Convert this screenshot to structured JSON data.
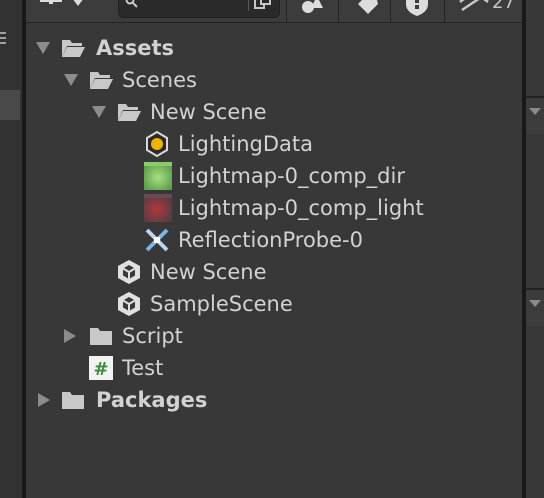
{
  "toolbar": {
    "search": {
      "value": "",
      "placeholder": ""
    },
    "hidden_count": "27",
    "icons": [
      "add-icon",
      "dropdown-caret-icon",
      "search-icon",
      "search-options-icon",
      "filter-by-type-icon",
      "filter-by-label-icon",
      "favorite-icon",
      "hidden-packages-icon"
    ]
  },
  "tree": {
    "items": [
      {
        "label": "Assets",
        "type": "folder-open",
        "expanded": true,
        "depth": 0
      },
      {
        "label": "Scenes",
        "type": "folder-open",
        "expanded": true,
        "depth": 1
      },
      {
        "label": "New Scene",
        "type": "folder-open",
        "expanded": true,
        "depth": 2
      },
      {
        "label": "LightingData",
        "type": "lighting-data",
        "depth": 3
      },
      {
        "label": "Lightmap-0_comp_dir",
        "type": "lightmap-dir",
        "depth": 3
      },
      {
        "label": "Lightmap-0_comp_light",
        "type": "lightmap-light",
        "depth": 3
      },
      {
        "label": "ReflectionProbe-0",
        "type": "reflection-probe",
        "depth": 3
      },
      {
        "label": "New Scene",
        "type": "unity-scene",
        "depth": 2
      },
      {
        "label": "SampleScene",
        "type": "unity-scene",
        "depth": 2
      },
      {
        "label": "Script",
        "type": "folder",
        "expanded": false,
        "depth": 1
      },
      {
        "label": "Test",
        "type": "csharp-script",
        "depth": 1
      },
      {
        "label": "Packages",
        "type": "folder",
        "expanded": false,
        "depth": 0
      }
    ]
  },
  "colors": {
    "panel_bg": "#383838",
    "toolbar_bg": "#3c3c3c",
    "text": "#d2d2d2",
    "folder_icon": "#c8c8c8",
    "script_icon_green": "#3c8c3c",
    "lighting_dot": "#f0b400"
  }
}
